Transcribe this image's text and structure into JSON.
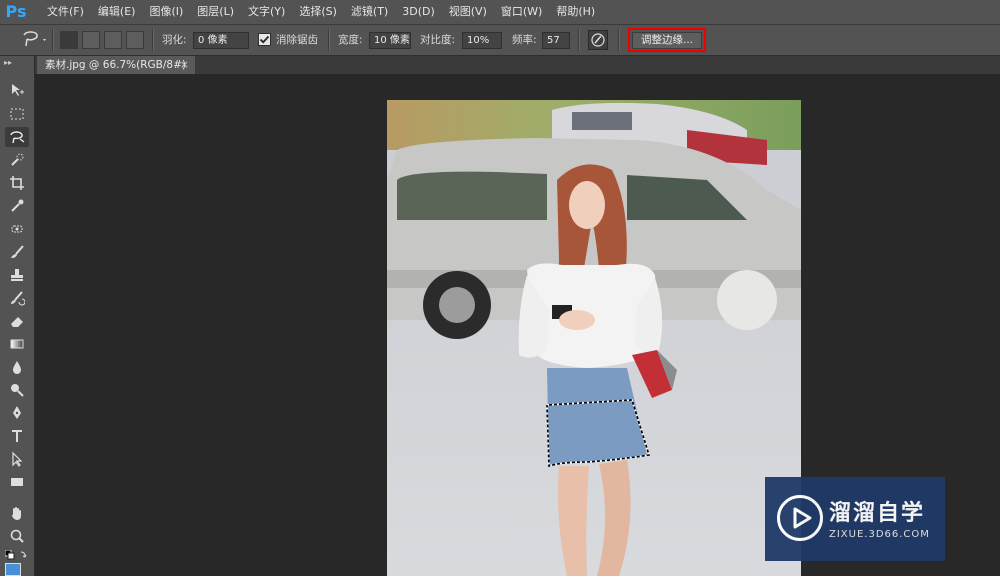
{
  "app": {
    "logo": "Ps"
  },
  "menu": [
    "文件(F)",
    "编辑(E)",
    "图像(I)",
    "图层(L)",
    "文字(Y)",
    "选择(S)",
    "滤镜(T)",
    "3D(D)",
    "视图(V)",
    "窗口(W)",
    "帮助(H)"
  ],
  "options": {
    "tool_icon": "lasso-icon",
    "feather_label": "羽化:",
    "feather_value": "0 像素",
    "antialias_checked": true,
    "antialias_label": "消除锯齿",
    "width_label": "宽度:",
    "width_value": "10 像素",
    "contrast_label": "对比度:",
    "contrast_value": "10%",
    "frequency_label": "频率:",
    "frequency_value": "57",
    "refine_edge_label": "调整边缘..."
  },
  "document": {
    "tab_title": "素材.jpg @ 66.7%(RGB/8#)",
    "close": "×"
  },
  "tools": [
    "move-icon",
    "marquee-icon",
    "magnetic-lasso-icon",
    "quick-selection-icon",
    "crop-icon",
    "eyedropper-icon",
    "healing-brush-icon",
    "brush-icon",
    "clone-stamp-icon",
    "history-brush-icon",
    "eraser-icon",
    "gradient-icon",
    "blur-icon",
    "dodge-icon",
    "pen-icon",
    "type-icon",
    "path-selection-icon",
    "rectangle-icon",
    "hand-icon",
    "zoom-icon"
  ],
  "watermark": {
    "title": "溜溜自学",
    "url": "ZIXUE.3D66.COM"
  },
  "colors": {
    "highlight": "#e00000",
    "ps_blue": "#31a8ff",
    "watermark_bg": "#1f3a68"
  }
}
